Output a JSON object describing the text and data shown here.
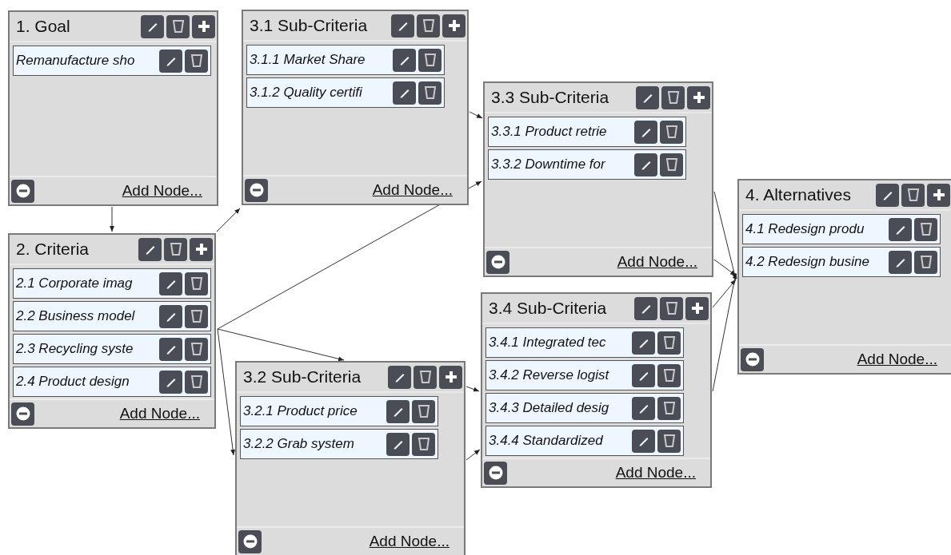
{
  "panels": [
    {
      "title": "1. Goal",
      "items": [
        {
          "label": "Remanufacture sho"
        }
      ],
      "action": "Add Node..."
    },
    {
      "title": "2. Criteria",
      "items": [
        {
          "label": "2.1 Corporate imag"
        },
        {
          "label": "2.2 Business model"
        },
        {
          "label": "2.3 Recycling syste"
        },
        {
          "label": "2.4 Product design"
        }
      ],
      "action": "Add Node..."
    },
    {
      "title": "3.1 Sub-Criteria",
      "items": [
        {
          "label": "3.1.1 Market Share"
        },
        {
          "label": "3.1.2 Quality certifi"
        }
      ],
      "action": "Add Node..."
    },
    {
      "title": "3.2 Sub-Criteria",
      "items": [
        {
          "label": "3.2.1 Product price"
        },
        {
          "label": "3.2.2 Grab system"
        }
      ],
      "action": "Add Node..."
    },
    {
      "title": "3.3 Sub-Criteria",
      "items": [
        {
          "label": "3.3.1 Product retrie"
        },
        {
          "label": "3.3.2 Downtime for"
        }
      ],
      "action": "Add Node..."
    },
    {
      "title": "3.4 Sub-Criteria",
      "items": [
        {
          "label": "3.4.1 Integrated tec"
        },
        {
          "label": "3.4.2 Reverse logist"
        },
        {
          "label": "3.4.3 Detailed desig"
        },
        {
          "label": "3.4.4 Standardized"
        }
      ],
      "action": "Add Node..."
    },
    {
      "title": "4. Alternatives",
      "items": [
        {
          "label": "4.1 Redesign produ"
        },
        {
          "label": "4.2 Redesign busine"
        }
      ],
      "action": "Add Node..."
    }
  ]
}
